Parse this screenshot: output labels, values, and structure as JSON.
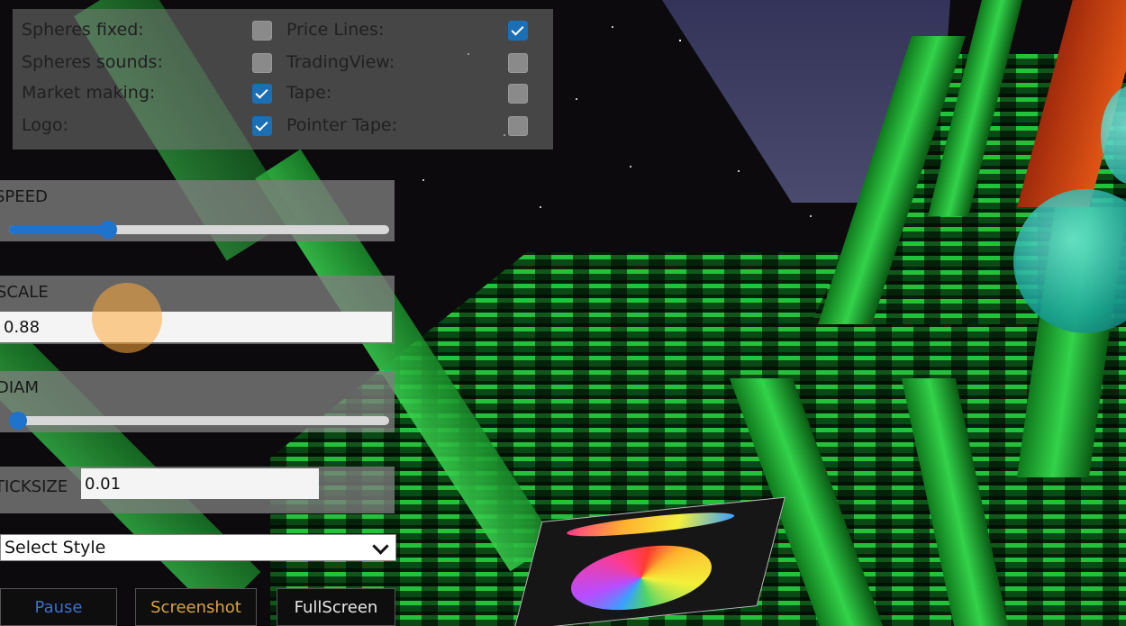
{
  "checkboxes_left": [
    {
      "label": "Spheres fixed:",
      "checked": false
    },
    {
      "label": "Spheres sounds:",
      "checked": false
    },
    {
      "label": "Market making:",
      "checked": true
    },
    {
      "label": "Logo:",
      "checked": true
    }
  ],
  "checkboxes_right": [
    {
      "label": "Price Lines:",
      "checked": true
    },
    {
      "label": "TradingView:",
      "checked": false
    },
    {
      "label": "Tape:",
      "checked": false
    },
    {
      "label": "Pointer Tape:",
      "checked": false
    }
  ],
  "controls": {
    "speed": {
      "label": "SPEED",
      "value_fraction": 0.26
    },
    "scale": {
      "label": "SCALE",
      "value": "0.88"
    },
    "diam": {
      "label": "DIAM",
      "value_fraction": 0.0
    },
    "ticksize": {
      "label": "TICKSIZE",
      "value": "0.01"
    }
  },
  "style_select": {
    "selected": "Select Style"
  },
  "buttons": {
    "pause": {
      "label": "Pause",
      "color": "#3b6fd1"
    },
    "screenshot": {
      "label": "Screenshot",
      "color": "#d9a441"
    },
    "fullscreen": {
      "label": "FullScreen",
      "color": "#e8e8e8"
    }
  },
  "colors": {
    "accent": "#1f73cc",
    "panel": "#7d7d7d",
    "scene_green": "#22c23a",
    "scene_sky": "#3a3a58"
  },
  "icons": {
    "select_chevron": "chevron-down-icon",
    "checkbox_check": "checkmark-icon"
  }
}
